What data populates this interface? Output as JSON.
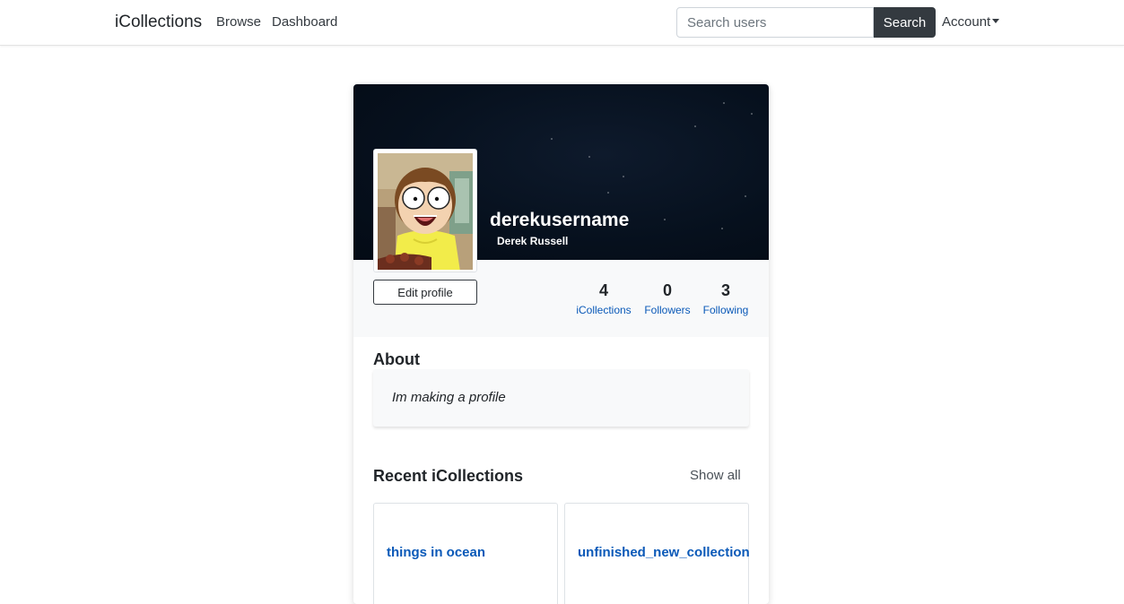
{
  "navbar": {
    "brand": "iCollections",
    "links": [
      "Browse",
      "Dashboard"
    ],
    "search_placeholder": "Search users",
    "search_button": "Search",
    "account": "Account"
  },
  "profile": {
    "username": "derekusername",
    "full_name": "Derek Russell",
    "edit_button": "Edit profile",
    "stats": [
      {
        "value": "4",
        "label": "iCollections"
      },
      {
        "value": "0",
        "label": "Followers"
      },
      {
        "value": "3",
        "label": "Following"
      }
    ]
  },
  "about": {
    "title": "About",
    "text": "Im making a profile"
  },
  "recent": {
    "title": "Recent iCollections",
    "show_all": "Show all",
    "collections": [
      "things in ocean",
      "unfinished_new_collection"
    ]
  },
  "colors": {
    "navbar_button": "#343a40",
    "link": "#0a59b8",
    "cover": "#06101d"
  }
}
